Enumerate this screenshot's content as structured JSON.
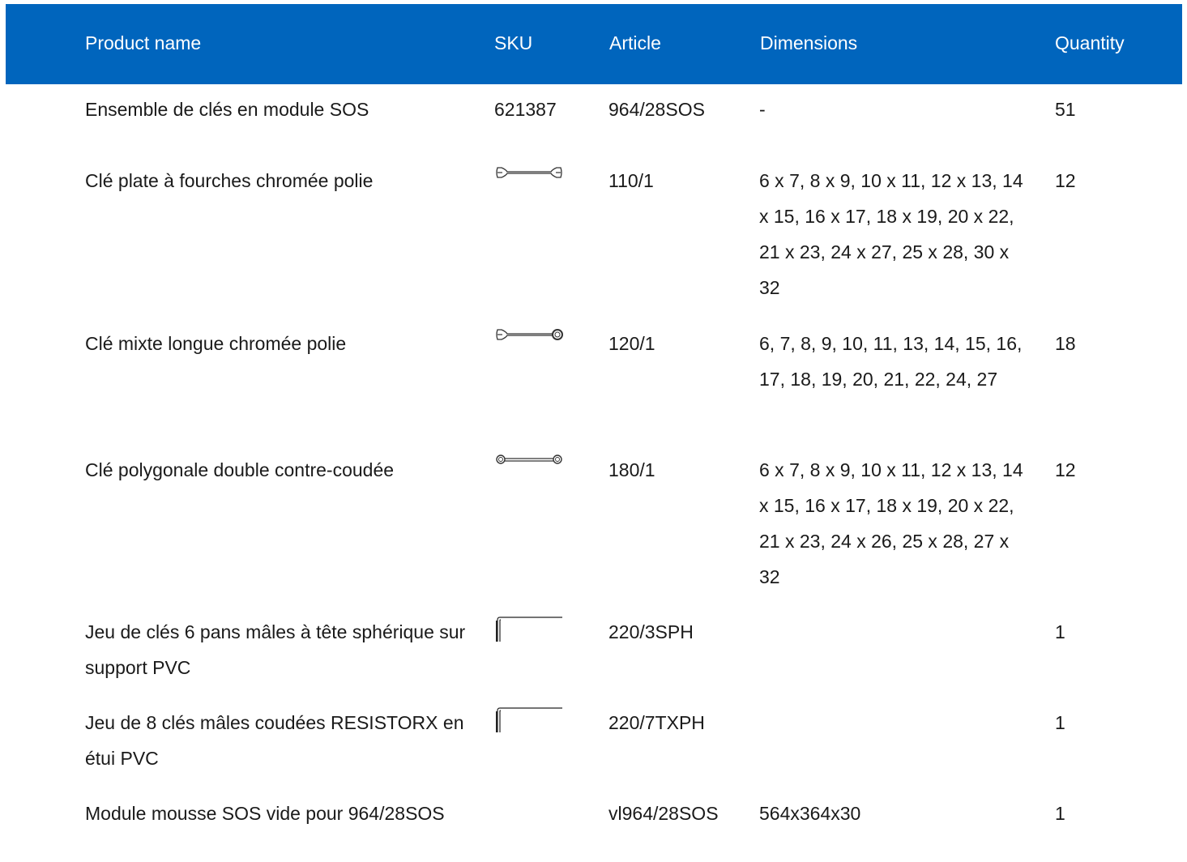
{
  "table": {
    "headers": {
      "product_name": "Product name",
      "sku": "SKU",
      "article": "Article",
      "dimensions": "Dimensions",
      "quantity": "Quantity"
    },
    "rows": [
      {
        "product_name": "Ensemble de clés en module SOS",
        "sku": "621387",
        "article": "964/28SOS",
        "dimensions": "-",
        "quantity": "51"
      },
      {
        "product_name": "Clé plate à fourches chromée polie",
        "sku_icon": "open-end-wrench-icon",
        "article": "110/1",
        "dimensions": "6 x 7, 8 x 9, 10 x 11, 12 x 13, 14 x 15, 16 x 17, 18 x 19, 20 x 22, 21 x 23, 24 x 27, 25 x 28, 30 x 32",
        "quantity": "12"
      },
      {
        "product_name": "Clé mixte longue chromée polie",
        "sku_icon": "combination-wrench-icon",
        "article": "120/1",
        "dimensions": "6, 7, 8, 9, 10, 11, 13, 14, 15, 16, 17, 18, 19, 20, 21, 22, 24, 27",
        "quantity": "18"
      },
      {
        "product_name": "Clé polygonale double contre-coudée",
        "sku_icon": "ring-wrench-icon",
        "article": "180/1",
        "dimensions": "6 x 7, 8 x 9, 10 x 11, 12 x 13, 14 x 15, 16 x 17, 18 x 19, 20 x 22, 21 x 23, 24 x 26, 25 x 28, 27 x 32",
        "quantity": "12"
      },
      {
        "product_name": "Jeu de clés 6 pans mâles à tête sphérique sur support PVC",
        "sku_icon": "hex-key-icon",
        "article": "220/3SPH",
        "dimensions": "",
        "quantity": "1"
      },
      {
        "product_name": "Jeu de 8 clés mâles coudées RESISTORX en étui PVC",
        "sku_icon": "torx-key-icon",
        "article": "220/7TXPH",
        "dimensions": "",
        "quantity": "1"
      },
      {
        "product_name": "Module mousse SOS vide pour 964/28SOS",
        "article": "vl964/28SOS",
        "dimensions": "564x364x30",
        "quantity": "1"
      }
    ]
  },
  "colors": {
    "header_background": "#0065bd",
    "header_text": "#ffffff",
    "body_text": "#1a1a1a"
  }
}
